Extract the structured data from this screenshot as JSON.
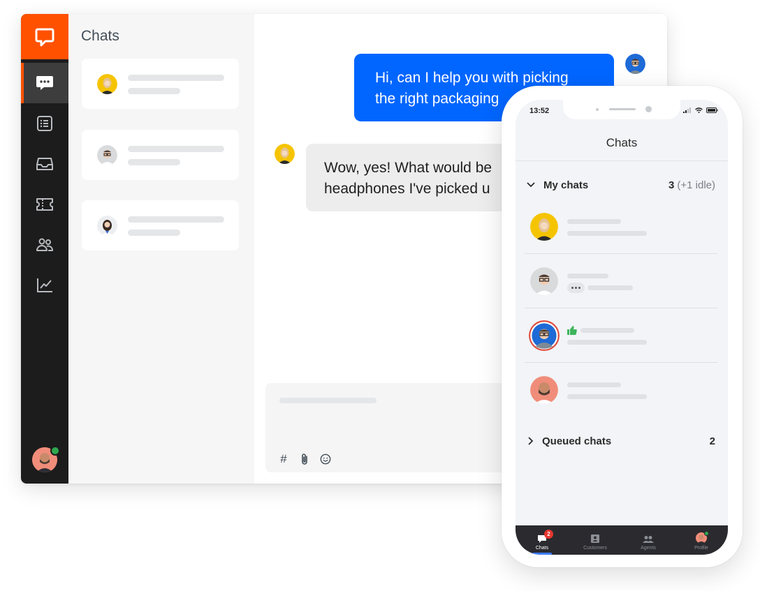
{
  "colors": {
    "brand": "#ff5100",
    "agent_bubble": "#0066ff",
    "online": "#2ea84e",
    "badge": "#e5372e"
  },
  "desktop": {
    "list_title": "Chats",
    "nav_icons": [
      "chats-icon",
      "list-icon",
      "inbox-icon",
      "ticket-icon",
      "customers-icon",
      "reports-icon"
    ],
    "messages": {
      "agent": "Hi, can I help you with picking\nthe right packaging",
      "customer": "Wow, yes! What would be\nheadphones I've picked u"
    },
    "composer_icons": [
      "hash-icon",
      "paperclip-icon",
      "emoji-icon"
    ],
    "composer_hash": "#"
  },
  "phone": {
    "status_time": "13:52",
    "title": "Chats",
    "my_chats": {
      "label": "My chats",
      "count": "3",
      "idle": "(+1 idle)"
    },
    "queued_chats": {
      "label": "Queued chats",
      "count": "2"
    },
    "tabs": [
      {
        "label": "Chats",
        "icon": "chat-icon",
        "badge": "2",
        "active": true
      },
      {
        "label": "Customers",
        "icon": "contact-card-icon"
      },
      {
        "label": "Agents",
        "icon": "agents-icon"
      },
      {
        "label": "Profile",
        "icon": "profile-avatar"
      }
    ]
  }
}
